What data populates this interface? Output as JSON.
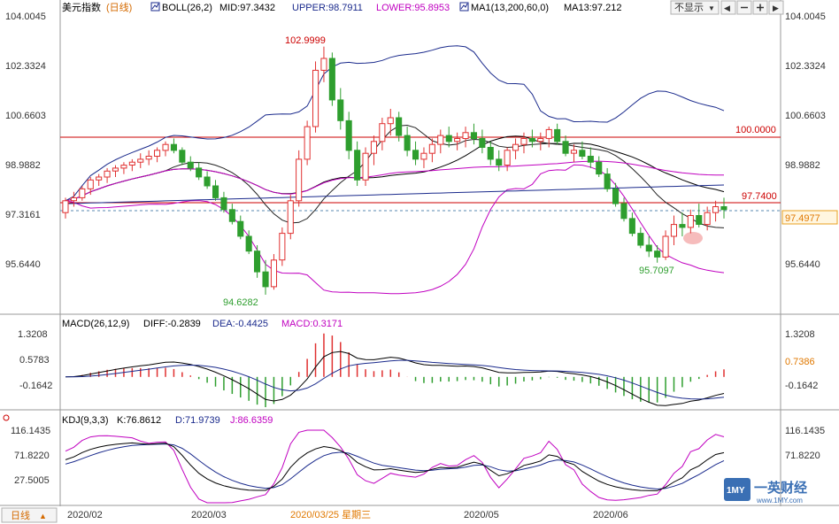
{
  "header": {
    "symbol": "美元指数",
    "period": "(日线)",
    "boll_label": "BOLL(26,2)",
    "mid": "MID:97.3432",
    "upper": "UPPER:98.7911",
    "lower": "LOWER:95.8953",
    "ma1": "MA1(13,200,60,0)",
    "ma13": "MA13:97.212",
    "hide_label": "不显示",
    "dropdown_arrow": "▼",
    "nav_left": "◀",
    "nav_right": "▶"
  },
  "macd_header": {
    "label": "MACD(26,12,9)",
    "diff": "DIFF:-0.2839",
    "dea": "DEA:-0.4425",
    "macd": "MACD:0.3171"
  },
  "kdj_header": {
    "label": "KDJ(9,3,3)",
    "k": "K:76.8612",
    "d": "D:71.9739",
    "j": "J:86.6359"
  },
  "bottom": {
    "period_button": "日线",
    "period_arrow": "▲",
    "x_labels": [
      "2020/02",
      "2020/03",
      "2020/03/25 星期三",
      "2020/05",
      "2020/06"
    ]
  },
  "price_axis": {
    "ticks": [
      "104.0045",
      "102.3324",
      "100.6603",
      "98.9882",
      "97.3161",
      "95.6440"
    ],
    "current_price": "97.4977"
  },
  "macd_axis": {
    "ticks": [
      "1.3208",
      "0.5783",
      "-0.1642"
    ],
    "current": "0.7386"
  },
  "kdj_axis": {
    "ticks": [
      "116.1435",
      "71.8220",
      "27.5005"
    ]
  },
  "annotations": {
    "high": "102.9999",
    "low": "94.6282",
    "low2": "95.7097",
    "level_100": "100.0000",
    "level_9774": "97.7400"
  },
  "watermark": {
    "brand": "一英财经",
    "url": "www.1MY.com",
    "logo_text": "1MY"
  },
  "colors": {
    "up": "#e03030",
    "down": "#2e9e2e",
    "mid": "#1a2a8c",
    "grid": "#d0d0d0",
    "level": "#cc0000"
  },
  "chart_data": [
    {
      "type": "line",
      "title": "美元指数 (日线)",
      "series": [
        {
          "name": "MID",
          "last": 97.3432
        },
        {
          "name": "UPPER",
          "last": 98.7911
        },
        {
          "name": "LOWER",
          "last": 95.8953
        },
        {
          "name": "MA13",
          "last": 97.212
        }
      ],
      "ylim": [
        94.6282,
        104.0045
      ],
      "candles": [
        [
          97.4,
          97.9,
          97.2,
          97.8
        ],
        [
          97.8,
          98.1,
          97.6,
          97.9
        ],
        [
          97.9,
          98.3,
          97.8,
          98.2
        ],
        [
          98.2,
          98.6,
          98.0,
          98.5
        ],
        [
          98.5,
          98.7,
          98.3,
          98.6
        ],
        [
          98.6,
          98.9,
          98.4,
          98.8
        ],
        [
          98.8,
          99.0,
          98.6,
          98.9
        ],
        [
          98.9,
          99.1,
          98.7,
          99.0
        ],
        [
          99.0,
          99.2,
          98.8,
          99.1
        ],
        [
          99.1,
          99.4,
          98.9,
          99.2
        ],
        [
          99.2,
          99.5,
          99.0,
          99.3
        ],
        [
          99.3,
          99.6,
          99.1,
          99.5
        ],
        [
          99.5,
          99.8,
          99.3,
          99.7
        ],
        [
          99.7,
          99.9,
          99.4,
          99.5
        ],
        [
          99.5,
          99.6,
          99.0,
          99.1
        ],
        [
          99.1,
          99.3,
          98.8,
          98.9
        ],
        [
          98.9,
          99.1,
          98.5,
          98.6
        ],
        [
          98.6,
          98.8,
          98.2,
          98.3
        ],
        [
          98.3,
          98.5,
          97.8,
          97.9
        ],
        [
          97.9,
          98.1,
          97.4,
          97.5
        ],
        [
          97.5,
          97.7,
          97.0,
          97.1
        ],
        [
          97.1,
          97.3,
          96.5,
          96.6
        ],
        [
          96.6,
          96.8,
          96.0,
          96.1
        ],
        [
          96.1,
          96.3,
          95.2,
          95.4
        ],
        [
          95.4,
          95.8,
          94.63,
          94.9
        ],
        [
          94.9,
          96.0,
          94.8,
          95.8
        ],
        [
          95.8,
          96.9,
          95.6,
          96.7
        ],
        [
          96.7,
          98.0,
          96.5,
          97.8
        ],
        [
          97.8,
          99.5,
          97.6,
          99.2
        ],
        [
          99.2,
          100.5,
          99.0,
          100.3
        ],
        [
          100.3,
          102.5,
          100.1,
          102.2
        ],
        [
          102.2,
          103.0,
          101.8,
          102.6
        ],
        [
          102.6,
          102.8,
          101.0,
          101.2
        ],
        [
          101.2,
          101.6,
          100.2,
          100.5
        ],
        [
          100.5,
          100.8,
          99.2,
          99.5
        ],
        [
          99.5,
          99.8,
          98.3,
          98.5
        ],
        [
          98.5,
          99.6,
          98.3,
          99.4
        ],
        [
          99.4,
          100.0,
          99.0,
          99.8
        ],
        [
          99.8,
          100.6,
          99.5,
          100.4
        ],
        [
          100.4,
          100.9,
          100.0,
          100.6
        ],
        [
          100.6,
          100.8,
          99.8,
          100.0
        ],
        [
          100.0,
          100.3,
          99.3,
          99.5
        ],
        [
          99.5,
          99.8,
          99.0,
          99.2
        ],
        [
          99.2,
          99.6,
          98.9,
          99.4
        ],
        [
          99.4,
          99.9,
          99.1,
          99.7
        ],
        [
          99.7,
          100.2,
          99.4,
          100.0
        ],
        [
          100.0,
          100.3,
          99.6,
          99.8
        ],
        [
          99.8,
          100.1,
          99.5,
          99.9
        ],
        [
          99.9,
          100.3,
          99.6,
          100.1
        ],
        [
          100.1,
          100.4,
          99.7,
          99.9
        ],
        [
          99.9,
          100.2,
          99.4,
          99.6
        ],
        [
          99.6,
          99.8,
          99.0,
          99.2
        ],
        [
          99.2,
          99.5,
          98.8,
          99.0
        ],
        [
          99.0,
          99.6,
          98.8,
          99.5
        ],
        [
          99.5,
          99.9,
          99.2,
          99.7
        ],
        [
          99.7,
          100.1,
          99.4,
          99.9
        ],
        [
          99.9,
          100.2,
          99.6,
          99.8
        ],
        [
          99.8,
          100.1,
          99.5,
          99.9
        ],
        [
          99.9,
          100.3,
          99.6,
          100.2
        ],
        [
          100.2,
          100.4,
          99.7,
          99.8
        ],
        [
          99.8,
          100.0,
          99.3,
          99.4
        ],
        [
          99.4,
          99.7,
          99.1,
          99.5
        ],
        [
          99.5,
          99.8,
          99.2,
          99.3
        ],
        [
          99.3,
          99.6,
          98.9,
          99.1
        ],
        [
          99.1,
          99.3,
          98.6,
          98.7
        ],
        [
          98.7,
          98.9,
          98.1,
          98.2
        ],
        [
          98.2,
          98.4,
          97.6,
          97.7
        ],
        [
          97.7,
          97.9,
          97.1,
          97.2
        ],
        [
          97.2,
          97.4,
          96.6,
          96.7
        ],
        [
          96.7,
          96.9,
          96.2,
          96.3
        ],
        [
          96.3,
          96.6,
          95.9,
          96.1
        ],
        [
          96.1,
          96.3,
          95.71,
          95.9
        ],
        [
          95.9,
          96.8,
          95.8,
          96.6
        ],
        [
          96.6,
          97.3,
          96.3,
          97.0
        ],
        [
          97.0,
          97.4,
          96.6,
          96.9
        ],
        [
          96.9,
          97.5,
          96.7,
          97.3
        ],
        [
          97.3,
          97.7,
          96.9,
          97.0
        ],
        [
          97.0,
          97.6,
          96.8,
          97.4
        ],
        [
          97.4,
          97.8,
          97.1,
          97.6
        ],
        [
          97.6,
          97.9,
          97.2,
          97.5
        ]
      ]
    },
    {
      "type": "bar",
      "title": "MACD(26,12,9)",
      "series": [
        {
          "name": "DIFF",
          "last": -0.2839
        },
        {
          "name": "DEA",
          "last": -0.4425
        },
        {
          "name": "MACD",
          "last": 0.3171
        }
      ],
      "ylim": [
        -0.9067,
        1.3208
      ]
    },
    {
      "type": "line",
      "title": "KDJ(9,3,3)",
      "series": [
        {
          "name": "K",
          "last": 76.8612
        },
        {
          "name": "D",
          "last": 71.9739
        },
        {
          "name": "J",
          "last": 86.6359
        }
      ],
      "ylim": [
        -16.821,
        116.1435
      ]
    }
  ]
}
